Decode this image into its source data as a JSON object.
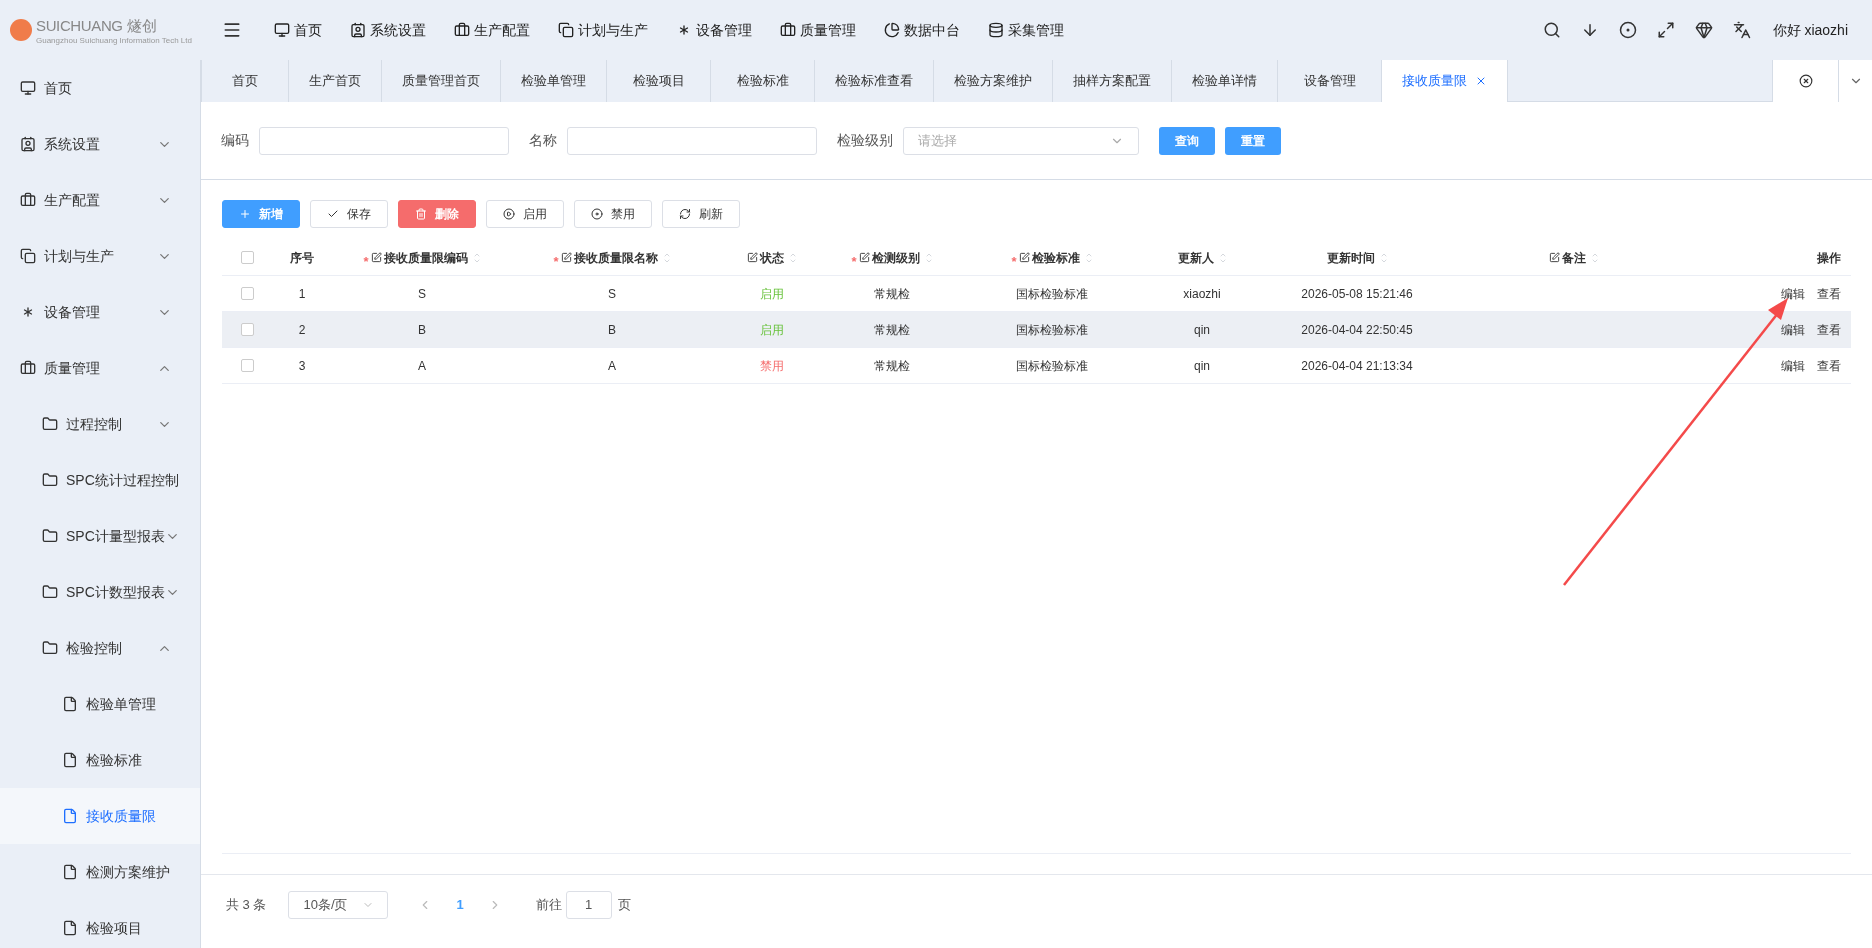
{
  "brand": {
    "name": "SUICHUANG",
    "name_cn": "燧创",
    "subtitle": "Guangzhou Suichuang Information Tech Ltd"
  },
  "top_nav": [
    "首页",
    "系统设置",
    "生产配置",
    "计划与生产",
    "设备管理",
    "质量管理",
    "数据中台",
    "采集管理"
  ],
  "user": "你好 xiaozhi",
  "sidebar": {
    "items": [
      {
        "label": "首页",
        "selected": false
      },
      {
        "label": "系统设置",
        "selected": false,
        "expanded": false
      },
      {
        "label": "生产配置",
        "selected": false,
        "expanded": false
      },
      {
        "label": "计划与生产",
        "selected": false,
        "expanded": false
      },
      {
        "label": "设备管理",
        "selected": false,
        "expanded": false
      },
      {
        "label": "质量管理",
        "selected": false,
        "expanded": true,
        "children": [
          {
            "label": "过程控制",
            "selected": false,
            "expanded": false
          },
          {
            "label": "SPC统计过程控制",
            "selected": false
          },
          {
            "label": "SPC计量型报表",
            "selected": false,
            "expanded": false
          },
          {
            "label": "SPC计数型报表",
            "selected": false,
            "expanded": false
          },
          {
            "label": "检验控制",
            "selected": false,
            "expanded": true,
            "children": [
              {
                "label": "检验单管理",
                "selected": false
              },
              {
                "label": "检验标准",
                "selected": false
              },
              {
                "label": "接收质量限",
                "selected": true
              },
              {
                "label": "检测方案维护",
                "selected": false
              },
              {
                "label": "检验项目",
                "selected": false
              }
            ]
          }
        ]
      }
    ]
  },
  "tabs": [
    {
      "label": "首页",
      "selected": false
    },
    {
      "label": "生产首页",
      "selected": false
    },
    {
      "label": "质量管理首页",
      "selected": false
    },
    {
      "label": "检验单管理",
      "selected": false
    },
    {
      "label": "检验项目",
      "selected": false
    },
    {
      "label": "检验标准",
      "selected": false
    },
    {
      "label": "检验标准查看",
      "selected": false
    },
    {
      "label": "检验方案维护",
      "selected": false
    },
    {
      "label": "抽样方案配置",
      "selected": false
    },
    {
      "label": "检验单详情",
      "selected": false
    },
    {
      "label": "设备管理",
      "selected": false
    },
    {
      "label": "接收质量限",
      "selected": true
    }
  ],
  "filters": [
    {
      "label": "编码",
      "kind": "text"
    },
    {
      "label": "名称",
      "kind": "text"
    },
    {
      "label": "检验级别",
      "kind": "select",
      "placeholder": "请选择"
    }
  ],
  "filter_buttons": [
    "查询",
    "重置"
  ],
  "toolbar": [
    {
      "label": "新增",
      "kind": "primary"
    },
    {
      "label": "保存",
      "kind": "default"
    },
    {
      "label": "删除",
      "kind": "danger"
    },
    {
      "label": "启用",
      "kind": "default"
    },
    {
      "label": "禁用",
      "kind": "default"
    },
    {
      "label": "刷新",
      "kind": "default"
    }
  ],
  "table": {
    "all_checked": false,
    "columns": [
      {
        "label": "序号"
      },
      {
        "label": "接收质量限编码",
        "required_mark": "*",
        "editable": true,
        "sortable": true
      },
      {
        "label": "接收质量限名称",
        "required_mark": "*",
        "editable": true,
        "sortable": true
      },
      {
        "label": "状态",
        "editable": true,
        "sortable": true
      },
      {
        "label": "检测级别",
        "required_mark": "*",
        "editable": true,
        "sortable": true
      },
      {
        "label": "检验标准",
        "required_mark": "*",
        "editable": true,
        "sortable": true
      },
      {
        "label": "更新人",
        "sortable": true
      },
      {
        "label": "更新时间",
        "sortable": true
      },
      {
        "label": "备注",
        "editable": true,
        "sortable": true
      },
      {
        "label": "操作"
      }
    ],
    "rows": [
      {
        "checked": false,
        "hovered": false,
        "cells": [
          "1",
          "S",
          "S"
        ],
        "status": {
          "text": "启用",
          "enabled": true
        },
        "rest": [
          "常规检",
          "国标检验标准",
          "xiaozhi",
          "2026-05-08 15:21:46"
        ],
        "actions": [
          "编辑",
          "查看"
        ]
      },
      {
        "checked": false,
        "hovered": true,
        "cells": [
          "2",
          "B",
          "B"
        ],
        "status": {
          "text": "启用",
          "enabled": true
        },
        "rest": [
          "常规检",
          "国标检验标准",
          "qin",
          "2026-04-04 22:50:45"
        ],
        "actions": [
          "编辑",
          "查看"
        ]
      },
      {
        "checked": false,
        "hovered": false,
        "cells": [
          "3",
          "A",
          "A"
        ],
        "status": {
          "text": "禁用",
          "enabled": false
        },
        "rest": [
          "常规检",
          "国标检验标准",
          "qin",
          "2026-04-04 21:13:34"
        ],
        "actions": [
          "编辑",
          "查看"
        ]
      }
    ]
  },
  "pagination": {
    "total": "共 3 条",
    "page_size": "10条/页",
    "pages": [
      {
        "label": "1",
        "selected": true
      }
    ],
    "goto_label": "前往",
    "goto_value": "1",
    "page_suffix": "页"
  }
}
